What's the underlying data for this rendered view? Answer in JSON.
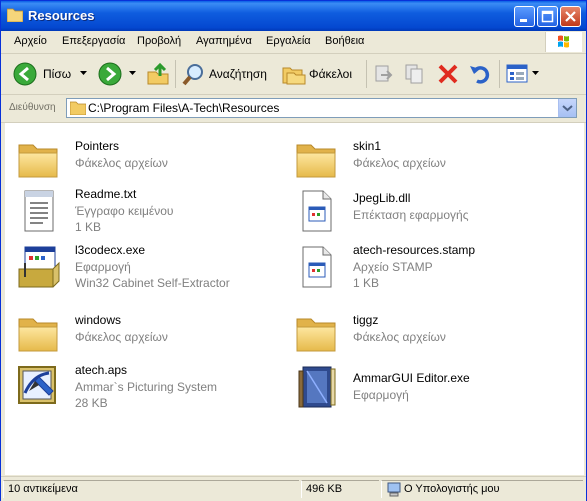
{
  "window": {
    "title": "Resources"
  },
  "menu": [
    "Αρχείο",
    "Επεξεργασία",
    "Προβολή",
    "Αγαπημένα",
    "Εργαλεία",
    "Βοήθεια"
  ],
  "toolbar": {
    "back_label": "Πίσω",
    "search_label": "Αναζήτηση",
    "folders_label": "Φάκελοι"
  },
  "address": {
    "label": "Διεύθυνση",
    "path": "C:\\Program Files\\A-Tech\\Resources"
  },
  "files": [
    {
      "name": "Pointers",
      "line1": "Φάκελος αρχείων",
      "line2": "",
      "icon": "folder-icon"
    },
    {
      "name": "skin1",
      "line1": "Φάκελος αρχείων",
      "line2": "",
      "icon": "folder-icon"
    },
    {
      "name": "Readme.txt",
      "line1": "Έγγραφο κειμένου",
      "line2": "1 KB",
      "icon": "text-document-icon"
    },
    {
      "name": "JpegLib.dll",
      "line1": "Επέκταση εφαρμογής",
      "line2": "",
      "icon": "dll-file-icon"
    },
    {
      "name": "l3codecx.exe",
      "line1": "Εφαρμογή",
      "line2": "Win32 Cabinet Self-Extractor",
      "icon": "installer-icon"
    },
    {
      "name": "atech-resources.stamp",
      "line1": "Αρχείο STAMP",
      "line2": "1 KB",
      "icon": "generic-file-icon"
    },
    {
      "name": "windows",
      "line1": "Φάκελος αρχείων",
      "line2": "",
      "icon": "folder-icon"
    },
    {
      "name": "tiggz",
      "line1": "Φάκελος αρχείων",
      "line2": "",
      "icon": "folder-icon"
    },
    {
      "name": "atech.aps",
      "line1": "Ammar`s Picturing System",
      "line2": "28 KB",
      "icon": "picture-file-icon"
    },
    {
      "name": "AmmarGUI Editor.exe",
      "line1": "Εφαρμογή",
      "line2": "",
      "icon": "book-application-icon"
    }
  ],
  "status": {
    "count": "10 αντικείμενα",
    "size": "496 KB",
    "location": "Ο Υπολογιστής μου"
  },
  "colors": {
    "titlebar": "#0448d0",
    "chrome": "#ece9d8",
    "accent": "#0831d9"
  }
}
